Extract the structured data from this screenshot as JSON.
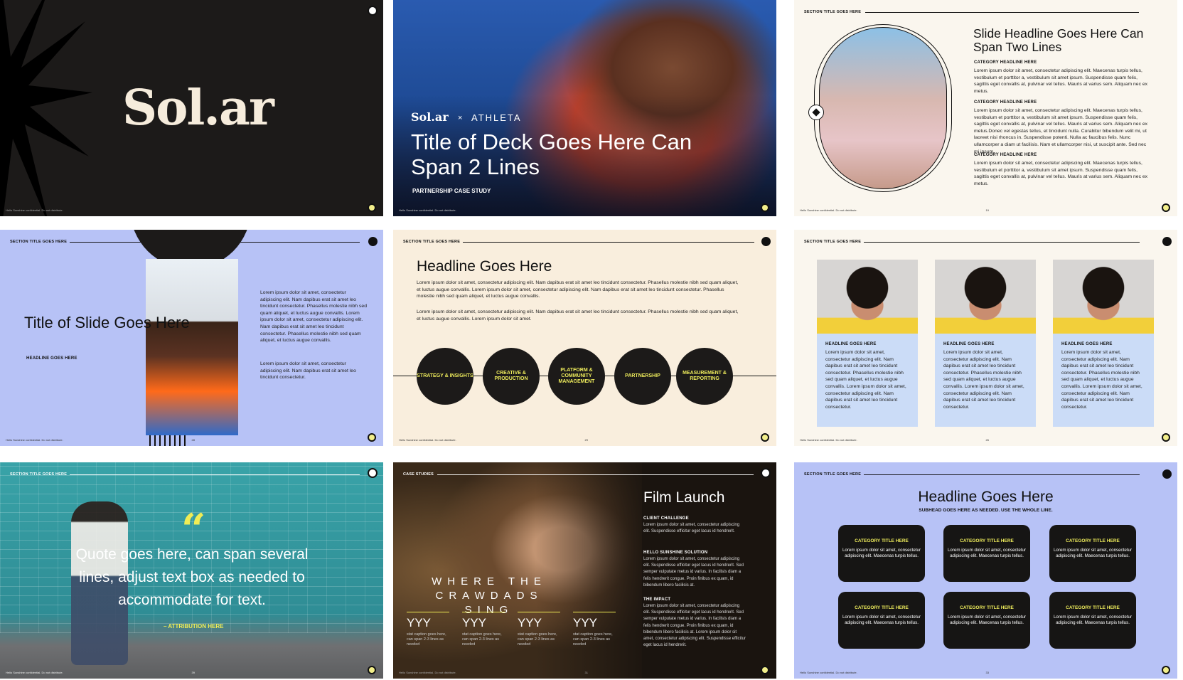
{
  "footer": "Hello Sunshine confidential. Do not distribute.",
  "section_title": "SECTION TITLE GOES HERE",
  "lorem_short": "Lorem ipsum dolor sit amet, consectetur adipiscing elit. Maecenas turpis tellus, vestibulum et porttitor a, vestibulum sit amet ipsum. Suspendisse quam felis, sagittis eget convallis at, pulvinar vel tellus. Mauris at varius sem. Aliquam nec ex metus.",
  "lorem_long": "Lorem ipsum dolor sit amet, consectetur adipiscing elit. Maecenas turpis tellus, vestibulum et porttitor a, vestibulum sit amet ipsum. Suspendisse quam felis, sagittis eget convallis at, pulvinar vel tellus. Mauris at varius sem. Aliquam nec ex metus.Donec vel egestas tellus, et tincidunt nulla. Curabitur bibendum velit mi, ut laoreet nisi rhoncus in. Suspendisse potenti. Nulla ac faucibus felis. Nunc ullamcorper a diam ut facilisis. Nam et ullamcorper nisi, ut suscipit ante. Sed nec mi ipsum.",
  "s1": {
    "logo": "Sol.ar"
  },
  "s2": {
    "brand": "Sol.ar",
    "x": "×",
    "partner": "ATHLETA",
    "title": "Title of Deck Goes Here Can Span 2 Lines",
    "kicker": "PARTNERSHIP CASE STUDY"
  },
  "s3": {
    "headline": "Slide Headline Goes Here Can Span Two Lines",
    "cat": "CATEGORY HEADLINE HERE",
    "page": "19"
  },
  "s4": {
    "title": "Title of Slide Goes Here",
    "cap": "HEADLINE GOES HERE",
    "p1": "Lorem ipsum dolor sit amet, consectetur adipiscing elit. Nam dapibus erat sit amet leo tincidunt consectetur. Phasellus molestie nibh sed quam aliquet, et luctus augue convallis. Lorem ipsum dolor sit amet, consectetur adipiscing elit. Nam dapibus erat sit amet leo tincidunt consectetur. Phasellus molestie nibh sed quam aliquet, et luctus augue convallis.",
    "p2": "Lorem ipsum dolor sit amet, consectetur adipiscing elit. Nam dapibus erat sit amet leo tincidunt consectetur.",
    "page": "28"
  },
  "s5": {
    "headline": "Headline Goes Here",
    "p1": "Lorem ipsum dolor sit amet, consectetur adipiscing elit. Nam dapibus erat sit amet leo tincidunt consectetur. Phasellus molestie nibh sed quam aliquet, et luctus augue convallis. Lorem ipsum dolor sit amet, consectetur adipiscing elit. Nam dapibus erat sit amet leo tincidunt consectetur. Phasellus molestie nibh sed quam aliquet, et luctus augue convallis.",
    "p2": "Lorem ipsum dolor sit amet, consectetur adipiscing elit. Nam dapibus erat sit amet leo tincidunt consectetur. Phasellus molestie nibh sed quam aliquet, et luctus augue convallis. Lorem ipsum dolor sit amet.",
    "steps": [
      "STRATEGY & INSIGHTS",
      "CREATIVE & PRODUCTION",
      "PLATFORM & COMMUNITY MANAGEMENT",
      "PARTNERSHIP",
      "MEASUREMENT & REPORTING"
    ],
    "page": "29"
  },
  "s6": {
    "cap": "HEADLINE GOES HERE",
    "text": "Lorem ipsum dolor sit amet, consectetur adipiscing elit. Nam dapibus erat sit amet leo tincidunt consectetur. Phasellus molestie nibh sed quam aliquet, et luctus augue convallis. Lorem ipsum dolor sit amet, consectetur adipiscing elit. Nam dapibus erat sit amet leo tincidunt consectetur.",
    "page": "26"
  },
  "s7": {
    "mark": "“",
    "quote": "Quote goes here, can span several lines, adjust text box as needed to accommodate for text.",
    "attr": "– ATTRIBUTION HERE",
    "page": "39"
  },
  "s8": {
    "section": "CASE STUDIES",
    "title": "Film Launch",
    "c1": "CLIENT CHALLENGE",
    "t1": "Lorem ipsum dolor sit amet, consectetur adipiscing elit. Suspendisse efficitur eget lacus id hendrerit.",
    "c2": "HELLO SUNSHINE SOLUTION",
    "t2": "Lorem ipsum dolor sit amet, consectetur adipiscing elit. Suspendisse efficitur eget lacus id hendrerit. Sed semper vulputate metus id varius. In facilisis diam a felis hendrerit congue. Proin finibus ex quam, id bibendum libero facilisis at.",
    "c3": "THE IMPACT",
    "t3": "Lorem ipsum dolor sit amet, consectetur adipiscing elit. Suspendisse efficitur eget lacus id hendrerit. Sed semper vulputate metus id varius. In facilisis diam a felis hendrerit congue. Proin finibus ex quam, id bibendum libero facilisis at. Lorem ipsum dolor sit amet, consectetur adipiscing elit. Suspendisse efficitur eget lacus id hendrerit.",
    "movie_line1": "WHERE THE",
    "movie_line2": "CRAWDADS SING",
    "stat_value": "YYY",
    "stat_caption": "stat caption goes here, can span 2-3 lines as needed",
    "page": "31"
  },
  "s9": {
    "headline": "Headline Goes Here",
    "sub": "SUBHEAD GOES HERE AS NEEDED. USE THE WHOLE LINE.",
    "tile_title": "CATEGORY TITLE HERE",
    "tile_text": "Lorem ipsum dolor sit amet, consectetur adipiscing elit. Maecenas turpis tellus.",
    "page": "33"
  }
}
